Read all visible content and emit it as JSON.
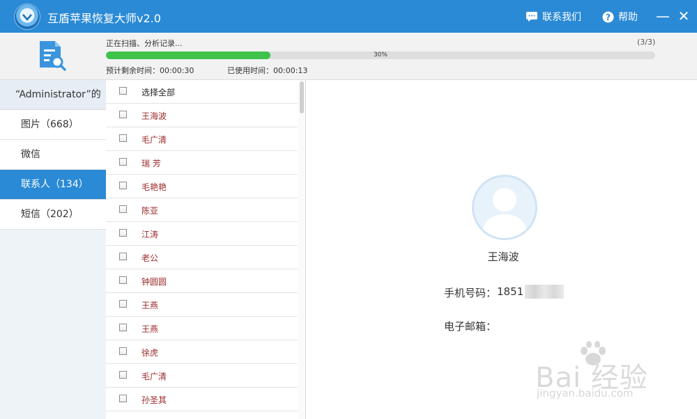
{
  "app": {
    "title": "互盾苹果恢复大师v2.0"
  },
  "titlebar": {
    "contact_label": "联系我们",
    "help_label": "帮助",
    "minimize_glyph": "—",
    "close_glyph": "✕"
  },
  "progress": {
    "status": "正在扫描、分析记录...",
    "step": "(3/3)",
    "percent_label": "30%",
    "percent": 30,
    "eta": "预计剩余时间：00:00:30",
    "elapsed": "已使用时间：00:00:13"
  },
  "sidebar": {
    "device": "“Administrator”的",
    "categories": [
      {
        "label": "图片（668）"
      },
      {
        "label": "微信"
      },
      {
        "label": "联系人（134）",
        "active": true
      },
      {
        "label": "短信（202）"
      }
    ]
  },
  "list": {
    "select_all": "选择全部",
    "contacts": [
      "王海波",
      "毛广清",
      "瑞 芳",
      "毛艳艳",
      "陈亚",
      "江涛",
      "老公",
      "钟圆圆",
      "王燕",
      "王燕",
      "徐虎",
      "毛广清",
      "孙圣其"
    ]
  },
  "detail": {
    "name": "王海波",
    "phone_label": "手机号码：",
    "phone_value": "1851",
    "email_label": "电子邮箱："
  },
  "watermark": {
    "main": "Bai 经验",
    "domain": "jingyan.baidu.com"
  },
  "colors": {
    "accent": "#2a8ad6",
    "progress": "#3fc34a",
    "contact_name": "#9b2a2a"
  }
}
